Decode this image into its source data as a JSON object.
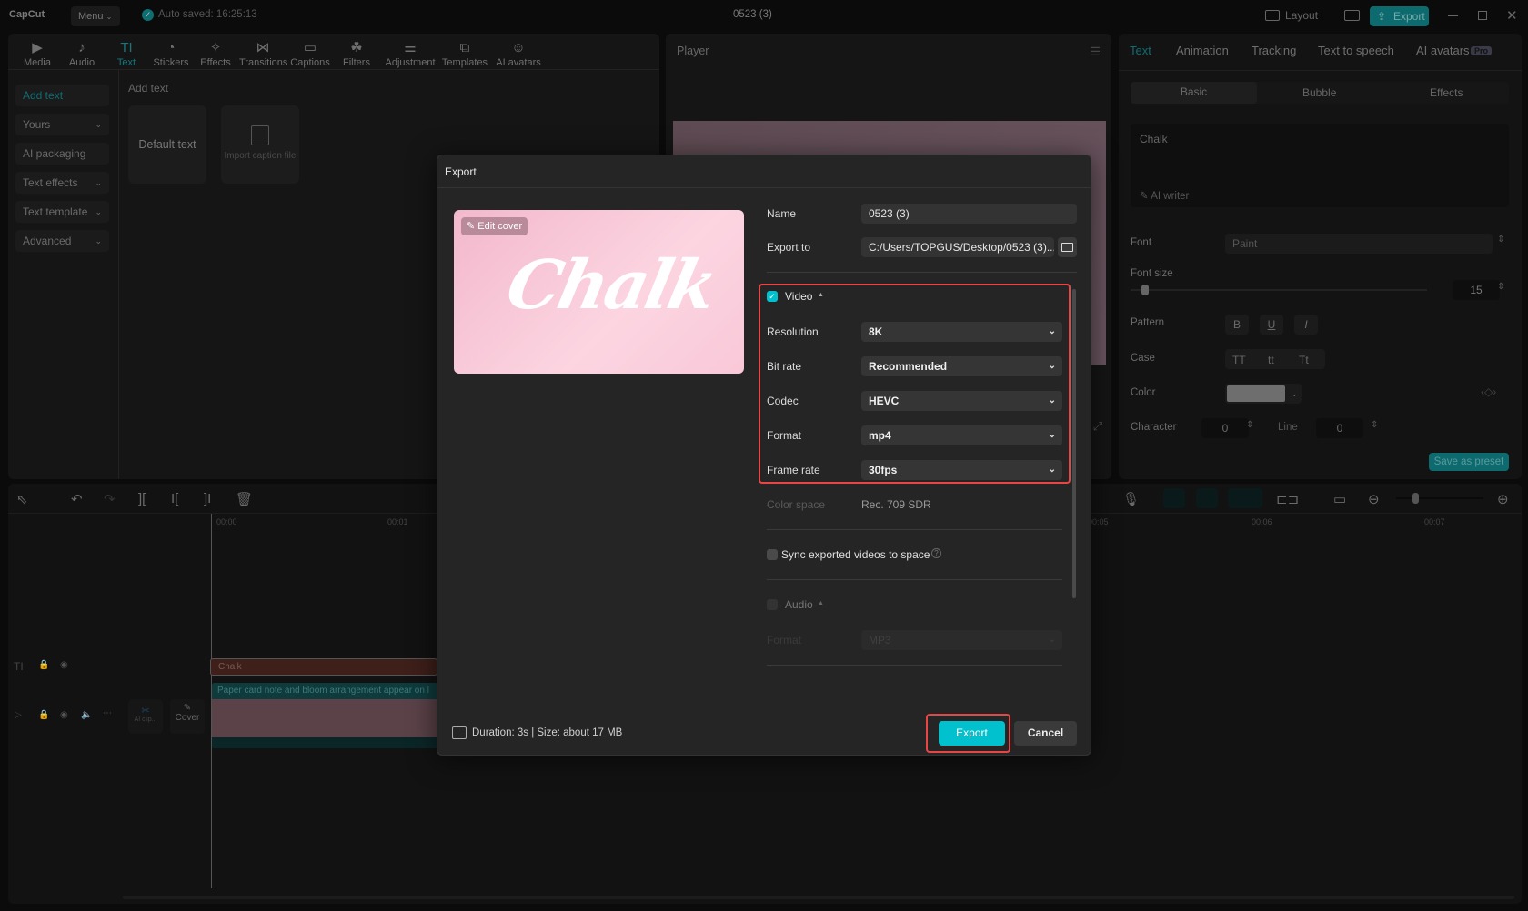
{
  "titlebar": {
    "logo": "CapCut",
    "menu_label": "Menu",
    "autosave": "Auto saved: 16:25:13",
    "project_title": "0523 (3)",
    "layout_label": "Layout",
    "export_label": "Export"
  },
  "toolbar": [
    {
      "label": "Media",
      "icon": "media-icon"
    },
    {
      "label": "Audio",
      "icon": "audio-icon"
    },
    {
      "label": "Text",
      "icon": "text-icon",
      "active": true
    },
    {
      "label": "Stickers",
      "icon": "stickers-icon"
    },
    {
      "label": "Effects",
      "icon": "effects-icon"
    },
    {
      "label": "Transitions",
      "icon": "transitions-icon"
    },
    {
      "label": "Captions",
      "icon": "captions-icon"
    },
    {
      "label": "Filters",
      "icon": "filters-icon"
    },
    {
      "label": "Adjustment",
      "icon": "adjustment-icon"
    },
    {
      "label": "Templates",
      "icon": "templates-icon"
    },
    {
      "label": "AI avatars",
      "icon": "ai-avatars-icon"
    }
  ],
  "sidebar": [
    "Add text",
    "Yours",
    "AI packaging",
    "Text effects",
    "Text template",
    "Advanced"
  ],
  "content": {
    "heading": "Add text",
    "default_text": "Default text",
    "import_caption": "Import caption file"
  },
  "player": {
    "title": "Player"
  },
  "inspector": {
    "tabs": [
      "Text",
      "Animation",
      "Tracking",
      "Text to speech",
      "AI avatars"
    ],
    "pro_badge": "Pro",
    "subtabs": [
      "Basic",
      "Bubble",
      "Effects"
    ],
    "text_value": "Chalk",
    "ai_writer": "AI writer",
    "font_label": "Font",
    "font_value": "Paint",
    "font_size_label": "Font size",
    "font_size_value": "15",
    "pattern_label": "Pattern",
    "pattern_buttons": [
      "B",
      "U",
      "I"
    ],
    "case_label": "Case",
    "case_buttons": [
      "TT",
      "tt",
      "Tt"
    ],
    "color_label": "Color",
    "color_value": "#6e6e6e",
    "character_label": "Character",
    "character_value": "0",
    "line_label": "Line",
    "line_value": "0",
    "save_preset": "Save as preset"
  },
  "timeline": {
    "ticks": [
      "00:00",
      "00:01",
      "00:05",
      "00:06",
      "00:07"
    ],
    "text_clip": "Chalk",
    "video_clip": "Paper card note and bloom arrangement appear on l",
    "ai_clip": "AI clip...",
    "cover": "Cover"
  },
  "export_dialog": {
    "title": "Export",
    "edit_cover": "Edit cover",
    "cover_text": "Chalk",
    "name_label": "Name",
    "name_value": "0523 (3)",
    "export_to_label": "Export to",
    "export_to_value": "C:/Users/TOPGUS/Desktop/0523 (3)...",
    "video_label": "Video",
    "video_checked": true,
    "resolution_label": "Resolution",
    "resolution_value": "8K",
    "bitrate_label": "Bit rate",
    "bitrate_value": "Recommended",
    "codec_label": "Codec",
    "codec_value": "HEVC",
    "format_label": "Format",
    "format_value": "mp4",
    "framerate_label": "Frame rate",
    "framerate_value": "30fps",
    "colorspace_label": "Color space",
    "colorspace_value": "Rec. 709 SDR",
    "sync_label": "Sync exported videos to space",
    "audio_label": "Audio",
    "audio_format_label": "Format",
    "audio_format_value": "MP3",
    "footer_info": "Duration: 3s | Size: about 17 MB",
    "export_button": "Export",
    "cancel_button": "Cancel"
  },
  "colors": {
    "accent": "#00c1cd",
    "highlight": "#e84545",
    "dialog_bg": "#252525"
  }
}
